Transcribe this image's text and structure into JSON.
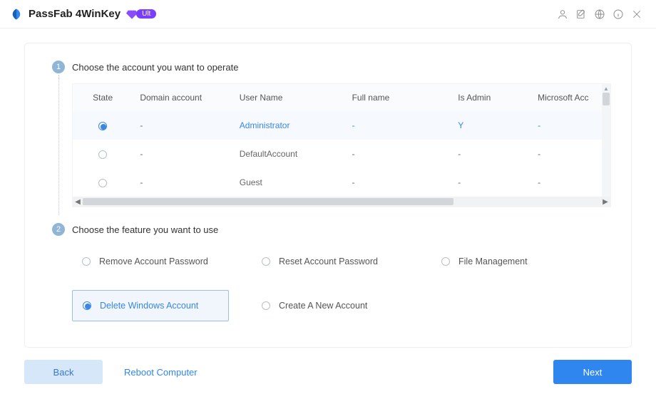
{
  "title": {
    "app_name": "PassFab 4WinKey",
    "badge": "Ult"
  },
  "step1": {
    "title": "Choose the account you want to operate",
    "columns": {
      "state": "State",
      "domain": "Domain account",
      "user": "User Name",
      "full": "Full name",
      "admin": "Is Admin",
      "ms": "Microsoft Acc"
    },
    "rows": [
      {
        "selected": true,
        "domain": "-",
        "user": "Administrator",
        "full": "-",
        "admin": "Y",
        "ms": "-"
      },
      {
        "selected": false,
        "domain": "-",
        "user": "DefaultAccount",
        "full": "-",
        "admin": "-",
        "ms": "-"
      },
      {
        "selected": false,
        "domain": "-",
        "user": "Guest",
        "full": "-",
        "admin": "-",
        "ms": "-"
      }
    ]
  },
  "step2": {
    "title": "Choose the feature you want to use",
    "options": [
      {
        "label": "Remove Account Password",
        "selected": false
      },
      {
        "label": "Reset Account Password",
        "selected": false
      },
      {
        "label": "File Management",
        "selected": false
      },
      {
        "label": "Delete Windows Account",
        "selected": true
      },
      {
        "label": "Create A New Account",
        "selected": false
      }
    ]
  },
  "buttons": {
    "back": "Back",
    "reboot": "Reboot Computer",
    "next": "Next"
  }
}
